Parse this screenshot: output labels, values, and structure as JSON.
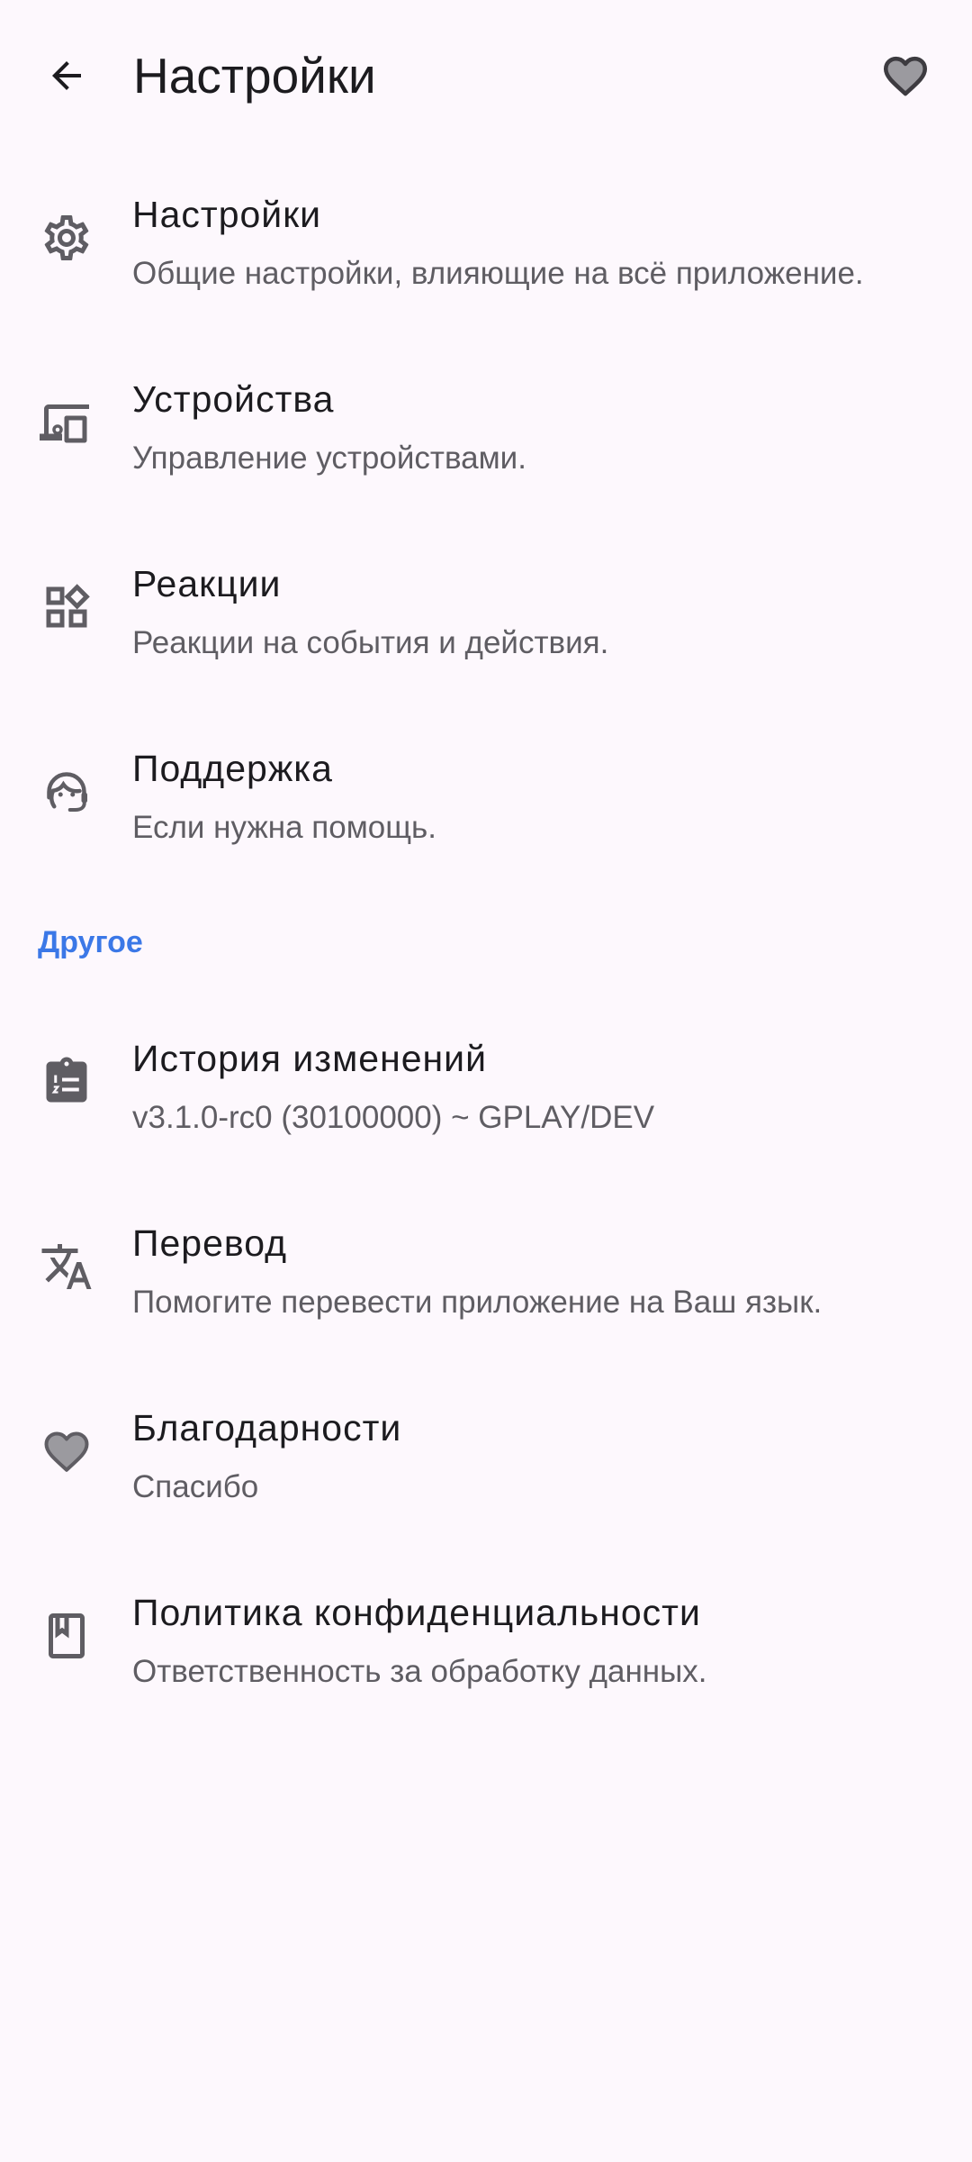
{
  "header": {
    "title": "Настройки",
    "back_icon": "arrow-back-icon",
    "favorite_icon": "heart-outline-icon"
  },
  "items": [
    {
      "icon": "gear-icon",
      "title": "Настройки",
      "subtitle": "Общие настройки, влияющие на всё приложение."
    },
    {
      "icon": "devices-icon",
      "title": "Устройства",
      "subtitle": "Управление устройствами."
    },
    {
      "icon": "widgets-icon",
      "title": "Реакции",
      "subtitle": "Реакции на события и действия."
    },
    {
      "icon": "support-agent-icon",
      "title": "Поддержка",
      "subtitle": "Если нужна помощь."
    }
  ],
  "section": {
    "label": "Другое"
  },
  "other_items": [
    {
      "icon": "clipboard-list-icon",
      "title": "История изменений",
      "subtitle": "v3.1.0-rc0 (30100000) ~ GPLAY/DEV"
    },
    {
      "icon": "translate-icon",
      "title": "Перевод",
      "subtitle": "Помогите перевести приложение на Ваш язык."
    },
    {
      "icon": "heart-icon",
      "title": "Благодарности",
      "subtitle": "Спасибо"
    },
    {
      "icon": "book-icon",
      "title": "Политика конфиденциальности",
      "subtitle": "Ответственность за обработку данных."
    }
  ],
  "colors": {
    "background": "#fdf8fd",
    "text_primary": "#1c1b1f",
    "text_secondary": "#5f5d63",
    "icon": "#5f5d63",
    "accent": "#3b78e7"
  }
}
